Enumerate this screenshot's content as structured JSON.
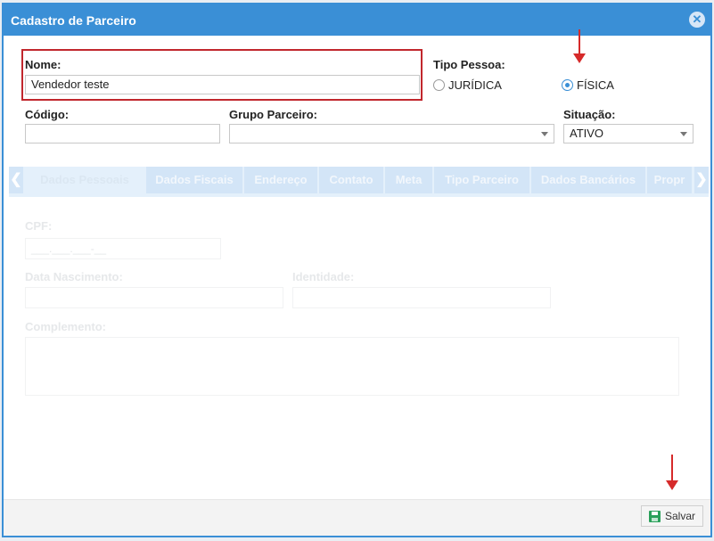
{
  "dialog": {
    "title": "Cadastro de Parceiro",
    "close_icon": "close-icon"
  },
  "form": {
    "nome_label": "Nome:",
    "nome_value": "Vendedor teste",
    "tipo_pessoa_label": "Tipo Pessoa:",
    "tipo_options": [
      {
        "label": "JURÍDICA",
        "checked": false
      },
      {
        "label": "FÍSICA",
        "checked": true
      }
    ],
    "codigo_label": "Código:",
    "codigo_value": "",
    "grupo_label": "Grupo Parceiro:",
    "grupo_value": "",
    "situacao_label": "Situação:",
    "situacao_value": "ATIVO"
  },
  "tabs": [
    "Dados Pessoais",
    "Dados Fiscais",
    "Endereço",
    "Contato",
    "Meta",
    "Tipo Parceiro",
    "Dados Bancários",
    "Propr"
  ],
  "tab_nav": {
    "prev": "❮",
    "next": "❯"
  },
  "faded": {
    "cpf_label": "CPF:",
    "cpf_mask": "___.___.___-__",
    "data_nascimento_label": "Data Nascimento:",
    "identidade_label": "Identidade:",
    "complemento_label": "Complemento:"
  },
  "footer": {
    "save_label": "Salvar",
    "save_icon": "save-icon"
  },
  "colors": {
    "accent": "#3a8fd6",
    "highlight": "#c1272d",
    "annotation_arrow": "#d62a2a",
    "save_icon": "#2aa05a"
  }
}
